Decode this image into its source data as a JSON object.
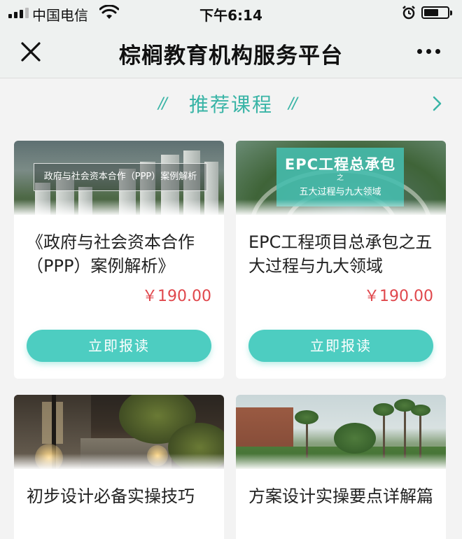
{
  "status_bar": {
    "carrier": "中国电信",
    "time": "下午6:14"
  },
  "nav": {
    "title": "棕榈教育机构服务平台"
  },
  "section": {
    "title": "推荐课程",
    "left_deco": "//",
    "right_deco": "//"
  },
  "courses": [
    {
      "image_caption": "政府与社会资本合作（PPP）案例解析",
      "title": "《政府与社会资本合作（PPP）案例解析》",
      "price": "￥190.00",
      "button": "立即报读"
    },
    {
      "image_caption": "EPC工程总承包",
      "image_caption_sub": "之",
      "image_caption_line2": "五大过程与九大领域",
      "title": "EPC工程项目总承包之五大过程与九大领域",
      "price": "￥190.00",
      "button": "立即报读"
    },
    {
      "title": "初步设计必备实操技巧"
    },
    {
      "title": "方案设计实操要点详解篇"
    }
  ],
  "colors": {
    "accent": "#39b4a6",
    "button": "#4dcdc1",
    "price": "#e0474c",
    "background": "#f3f3f3"
  },
  "icons": [
    "signal-icon",
    "wifi-icon",
    "alarm-icon",
    "battery-icon",
    "close-icon",
    "more-icon",
    "chevron-right-icon"
  ]
}
